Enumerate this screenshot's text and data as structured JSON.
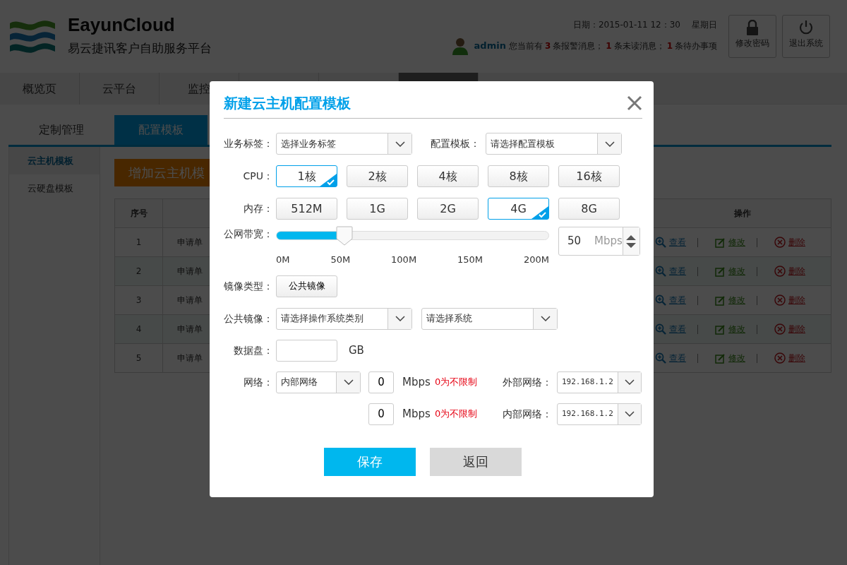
{
  "header": {
    "brand": "EayunCloud",
    "subtitle": "易云捷讯客户自助服务平台",
    "date": "日期：2015-01-11 12：30",
    "weekday": "星期日",
    "user": "admin",
    "notice": [
      {
        "kind": "text",
        "text": "您当前有"
      },
      {
        "kind": "count",
        "text": "3"
      },
      {
        "kind": "text",
        "text": "条报警消息；"
      },
      {
        "kind": "count",
        "text": "1"
      },
      {
        "kind": "text",
        "text": "条未读消息；"
      },
      {
        "kind": "count",
        "text": "1"
      },
      {
        "kind": "text",
        "text": "条待办事项"
      }
    ],
    "buttons": [
      {
        "kind": "lock",
        "label": "修改密码"
      },
      {
        "kind": "power",
        "label": "退出系统"
      }
    ]
  },
  "nav": [
    {
      "label": "概览页",
      "selected": false
    },
    {
      "label": "云平台",
      "selected": false
    },
    {
      "label": "监控",
      "selected": false
    },
    {
      "selected": false
    },
    {
      "selected": false
    },
    {
      "selected": true
    }
  ],
  "subtabs": [
    {
      "label": "定制管理",
      "selected": false
    },
    {
      "label": "配置模板",
      "selected": true
    }
  ],
  "sidebar": [
    {
      "label": "云主机模板",
      "selected": true
    },
    {
      "label": "云硬盘模板",
      "selected": false
    }
  ],
  "add_button": "增加云主机模",
  "table": {
    "columns": [
      "序号",
      "操作"
    ],
    "rows": [
      {
        "index": "1",
        "column_2": "申请单",
        "actions": [
          {
            "kind": "view",
            "label": "查看"
          },
          {
            "kind": "edit",
            "label": "修改"
          },
          {
            "kind": "delete",
            "label": "删除"
          }
        ]
      },
      {
        "index": "2",
        "column_2": "申请单",
        "actions": [
          {
            "kind": "view",
            "label": "查看"
          },
          {
            "kind": "edit",
            "label": "修改"
          },
          {
            "kind": "delete",
            "label": "删除"
          }
        ]
      },
      {
        "index": "3",
        "column_2": "申请单",
        "actions": [
          {
            "kind": "view",
            "label": "查看"
          },
          {
            "kind": "edit",
            "label": "修改"
          },
          {
            "kind": "delete",
            "label": "删除"
          }
        ]
      },
      {
        "index": "4",
        "column_2": "申请单",
        "actions": [
          {
            "kind": "view",
            "label": "查看"
          },
          {
            "kind": "edit",
            "label": "修改"
          },
          {
            "kind": "delete",
            "label": "删除"
          }
        ]
      },
      {
        "index": "5",
        "column_2": "申请单",
        "actions": [
          {
            "kind": "view",
            "label": "查看"
          },
          {
            "kind": "edit",
            "label": "修改"
          },
          {
            "kind": "delete",
            "label": "删除"
          }
        ]
      }
    ]
  },
  "dialog": {
    "title": "新建云主机配置模板",
    "selects": [
      {
        "label": "业务标签：",
        "value": "选择业务标签"
      },
      {
        "label": "配置模板：",
        "value": "请选择配置模板"
      }
    ],
    "cpu": {
      "label": "CPU：",
      "options": [
        {
          "label": "1核",
          "selected": true
        },
        {
          "label": "2核",
          "selected": false
        },
        {
          "label": "4核",
          "selected": false
        },
        {
          "label": "8核",
          "selected": false
        },
        {
          "label": "16核",
          "selected": false
        }
      ]
    },
    "memory": {
      "label": "内存：",
      "options": [
        {
          "label": "512M",
          "selected": false
        },
        {
          "label": "1G",
          "selected": false
        },
        {
          "label": "2G",
          "selected": false
        },
        {
          "label": "4G",
          "selected": true
        },
        {
          "label": "8G",
          "selected": false
        }
      ]
    },
    "bandwidth": {
      "label": "公网带宽：",
      "level": 0.25,
      "ticks": [
        "0M",
        "50M",
        "100M",
        "150M",
        "200M"
      ],
      "value": "50",
      "unit": "Mbps"
    },
    "image_type": {
      "label": "镜像类型：",
      "button": "公共镜像"
    },
    "public_image": {
      "label": "公共镜像：",
      "selects": [
        "请选择操作系统类别",
        "请选择系统"
      ]
    },
    "data_disk": {
      "label": "数据盘：",
      "unit": "GB"
    },
    "network": {
      "label": "网络：",
      "type": "内部网络",
      "lines": [
        {
          "value": "0",
          "unit": "Mbps",
          "hint": "0为不限制",
          "ip_label": "外部网络：",
          "ip": "192.168.1.2"
        },
        {
          "value": "0",
          "unit": "Mbps",
          "hint": "0为不限制",
          "ip_label": "内部网络：",
          "ip": "192.168.1.2"
        }
      ]
    },
    "buttons": [
      {
        "kind": "primary",
        "label": "保存"
      },
      {
        "kind": "secondary",
        "label": "返回"
      }
    ]
  }
}
